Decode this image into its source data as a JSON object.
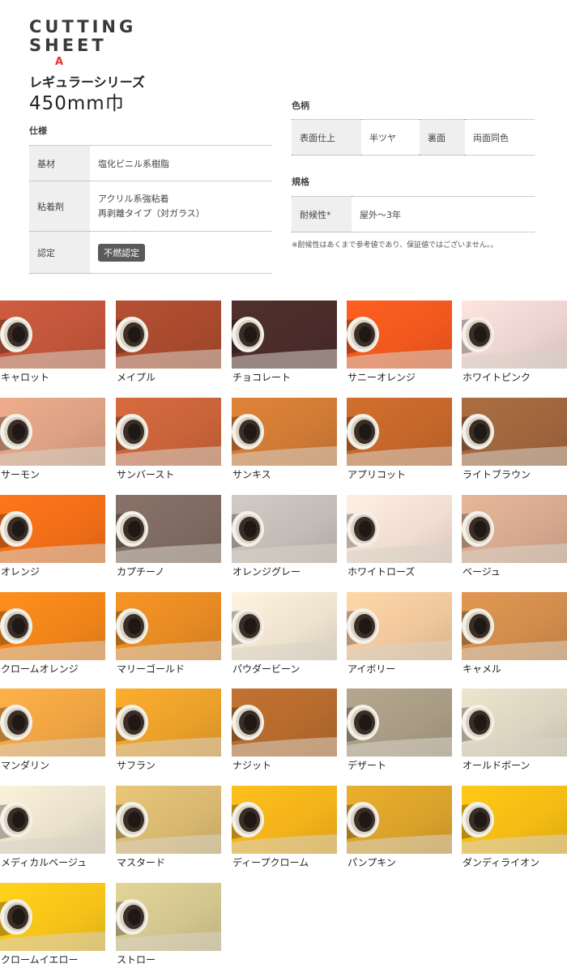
{
  "brand": {
    "line1": "CUTTING",
    "line2": "SHEET",
    "mark": "A"
  },
  "series_name": "レギュラーシリーズ",
  "roll_width": "450mm巾",
  "spec": {
    "heading": "仕様",
    "rows": [
      {
        "label": "基材",
        "value": "塩化ビニル系樹脂"
      },
      {
        "label": "粘着剤",
        "value": "アクリル系強粘着",
        "value2": "再剥離タイプ（対ガラス）"
      },
      {
        "label": "認定",
        "badge": "不燃認定"
      }
    ]
  },
  "pattern": {
    "heading": "色柄",
    "surface_label": "表面仕上",
    "surface_value": "半ツヤ",
    "back_label": "裏面",
    "back_value": "両面同色"
  },
  "standard": {
    "heading": "規格",
    "label": "耐候性*",
    "value": "屋外～3年"
  },
  "note": "※耐候性はあくまで参考値であり、保証値ではございません。。",
  "colors": [
    {
      "name": "キャロット",
      "color": "#c0553a"
    },
    {
      "name": "メイプル",
      "color": "#a84a2e"
    },
    {
      "name": "チョコレート",
      "color": "#4a2c2a"
    },
    {
      "name": "サニーオレンジ",
      "color": "#f0581e"
    },
    {
      "name": "ホワイトピンク",
      "color": "#ecd3cf"
    },
    {
      "name": "サーモン",
      "color": "#dca083"
    },
    {
      "name": "サンバースト",
      "color": "#c8633a"
    },
    {
      "name": "サンキス",
      "color": "#cf7a35"
    },
    {
      "name": "アプリコット",
      "color": "#c3672a"
    },
    {
      "name": "ライトブラウン",
      "color": "#a0653d"
    },
    {
      "name": "オレンジ",
      "color": "#f06d18"
    },
    {
      "name": "カプチーノ",
      "color": "#7e6a62"
    },
    {
      "name": "オレンジグレー",
      "color": "#c3bcb6"
    },
    {
      "name": "ホワイトローズ",
      "color": "#f1ddd2"
    },
    {
      "name": "ベージュ",
      "color": "#d6a98f"
    },
    {
      "name": "クロームオレンジ",
      "color": "#f0841a"
    },
    {
      "name": "マリーゴールド",
      "color": "#e58a23"
    },
    {
      "name": "パウダービーン",
      "color": "#eee2cf"
    },
    {
      "name": "アイボリー",
      "color": "#efc79c"
    },
    {
      "name": "キャメル",
      "color": "#d18c4c"
    },
    {
      "name": "マンダリン",
      "color": "#eea443"
    },
    {
      "name": "サフラン",
      "color": "#e9a02a"
    },
    {
      "name": "ナジット",
      "color": "#b56a2d"
    },
    {
      "name": "デザート",
      "color": "#a89b84"
    },
    {
      "name": "オールドボーン",
      "color": "#dcd4c0"
    },
    {
      "name": "メディカルベージュ",
      "color": "#e9e0cb"
    },
    {
      "name": "マスタード",
      "color": "#d8b870"
    },
    {
      "name": "ディープクローム",
      "color": "#f2b21a"
    },
    {
      "name": "パンプキン",
      "color": "#d9a22a"
    },
    {
      "name": "ダンディライオン",
      "color": "#f3bb14"
    },
    {
      "name": "クロームイエロー",
      "color": "#f5c318"
    },
    {
      "name": "ストロー",
      "color": "#d2c58e"
    }
  ]
}
